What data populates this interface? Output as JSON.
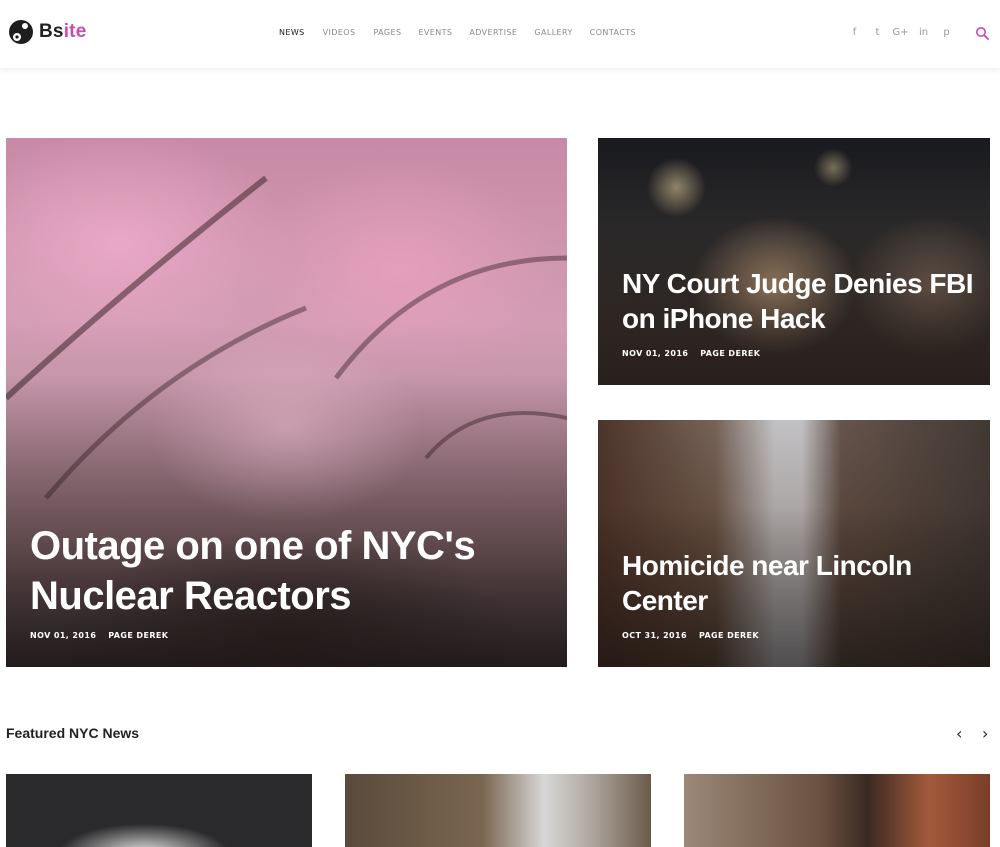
{
  "header": {
    "logo": {
      "prefix": "Bs",
      "accent": "ite",
      "accent_color": "#c64bb3"
    },
    "nav": [
      {
        "label": "NEWS",
        "active": true
      },
      {
        "label": "VIDEOS",
        "active": false
      },
      {
        "label": "PAGES",
        "active": false
      },
      {
        "label": "EVENTS",
        "active": false
      },
      {
        "label": "ADVERTISE",
        "active": false
      },
      {
        "label": "GALLERY",
        "active": false
      },
      {
        "label": "CONTACTS",
        "active": false
      }
    ],
    "social": [
      {
        "icon": "facebook-icon",
        "glyph": "f"
      },
      {
        "icon": "twitter-icon",
        "glyph": "t"
      },
      {
        "icon": "google-plus-icon",
        "glyph": "G+"
      },
      {
        "icon": "linkedin-icon",
        "glyph": "in"
      },
      {
        "icon": "pinterest-icon",
        "glyph": "p"
      }
    ],
    "search_icon": "search-icon"
  },
  "hero": {
    "main": {
      "title": "Outage on one of NYC's Nuclear Reactors",
      "date": "NOV 01, 2016",
      "author": "PAGE DEREK"
    },
    "side": [
      {
        "title": "NY Court Judge Denies FBI on iPhone Hack",
        "date": "NOV 01, 2016",
        "author": "PAGE DEREK"
      },
      {
        "title": "Homicide near Lincoln Center",
        "date": "OCT 31, 2016",
        "author": "PAGE DEREK"
      }
    ]
  },
  "featured": {
    "title": "Featured NYC News",
    "prev_glyph": "‹",
    "next_glyph": "›"
  }
}
